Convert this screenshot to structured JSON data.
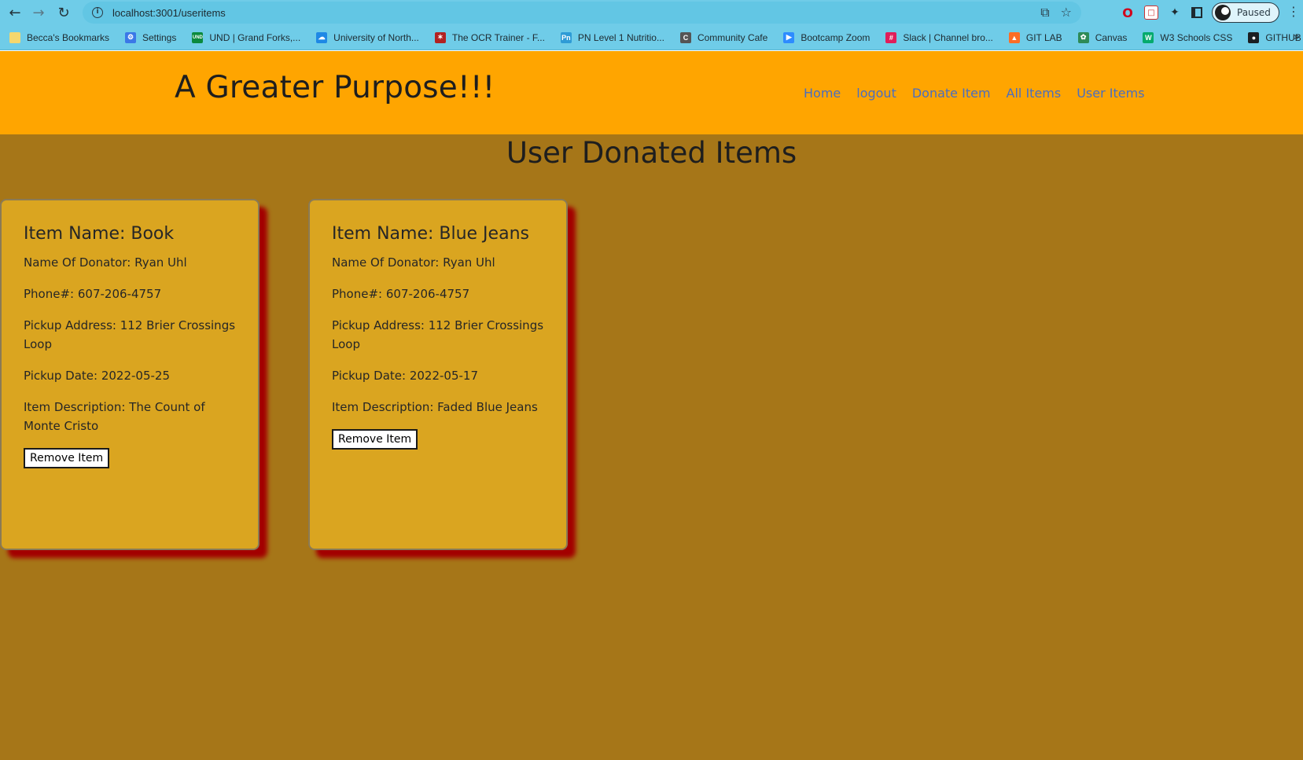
{
  "browser": {
    "url": "localhost:3001/useritems",
    "profile_status": "Paused",
    "bookmarks": [
      {
        "label": "Becca's Bookmarks",
        "icon": "folder-icon",
        "color": "#f5d76e"
      },
      {
        "label": "Settings",
        "icon": "gear-icon",
        "color": "#3b78e7"
      },
      {
        "label": "UND | Grand Forks,...",
        "icon": "und-icon",
        "color": "#0b8a3e"
      },
      {
        "label": "University of North...",
        "icon": "cloud-icon",
        "color": "#1e88e5"
      },
      {
        "label": "The OCR Trainer - F...",
        "icon": "ocr-icon",
        "color": "#b22222"
      },
      {
        "label": "PN Level 1 Nutritio...",
        "icon": "pn-icon",
        "color": "#2e9bd6"
      },
      {
        "label": "Community Cafe",
        "icon": "cafe-icon",
        "color": "#555555"
      },
      {
        "label": "Bootcamp Zoom",
        "icon": "zoom-icon",
        "color": "#2d8cff"
      },
      {
        "label": "Slack | Channel bro...",
        "icon": "slack-icon",
        "color": "#e01e5a"
      },
      {
        "label": "GIT LAB",
        "icon": "gitlab-icon",
        "color": "#fc6d26"
      },
      {
        "label": "Canvas",
        "icon": "canvas-icon",
        "color": "#2e8b57"
      },
      {
        "label": "W3 Schools CSS",
        "icon": "w3-icon",
        "color": "#04aa6d"
      },
      {
        "label": "GITHUB",
        "icon": "github-icon",
        "color": "#1b1f23"
      }
    ]
  },
  "header": {
    "title": "A Greater Purpose!!!",
    "nav": [
      "Home",
      "logout",
      "Donate Item",
      "All Items",
      "User Items"
    ]
  },
  "main": {
    "title": "User Donated Items",
    "items": [
      {
        "name": "Item Name: Book",
        "donator": "Name Of Donator: Ryan Uhl",
        "phone": "Phone#: 607-206-4757",
        "address": "Pickup Address: 112 Brier Crossings Loop",
        "date": "Pickup Date: 2022-05-25",
        "description": "Item Description: The Count of Monte Cristo",
        "remove_label": "Remove Item"
      },
      {
        "name": "Item Name: Blue Jeans",
        "donator": "Name Of Donator: Ryan Uhl",
        "phone": "Phone#: 607-206-4757",
        "address": "Pickup Address: 112 Brier Crossings Loop",
        "date": "Pickup Date: 2022-05-17",
        "description": "Item Description: Faded Blue Jeans",
        "remove_label": "Remove Item"
      }
    ]
  },
  "colors": {
    "header_bg": "#ffa500",
    "page_bg": "#a67618",
    "card_bg": "#daa520",
    "card_shadow": "#a30000",
    "nav_link": "#4a6ec0"
  }
}
